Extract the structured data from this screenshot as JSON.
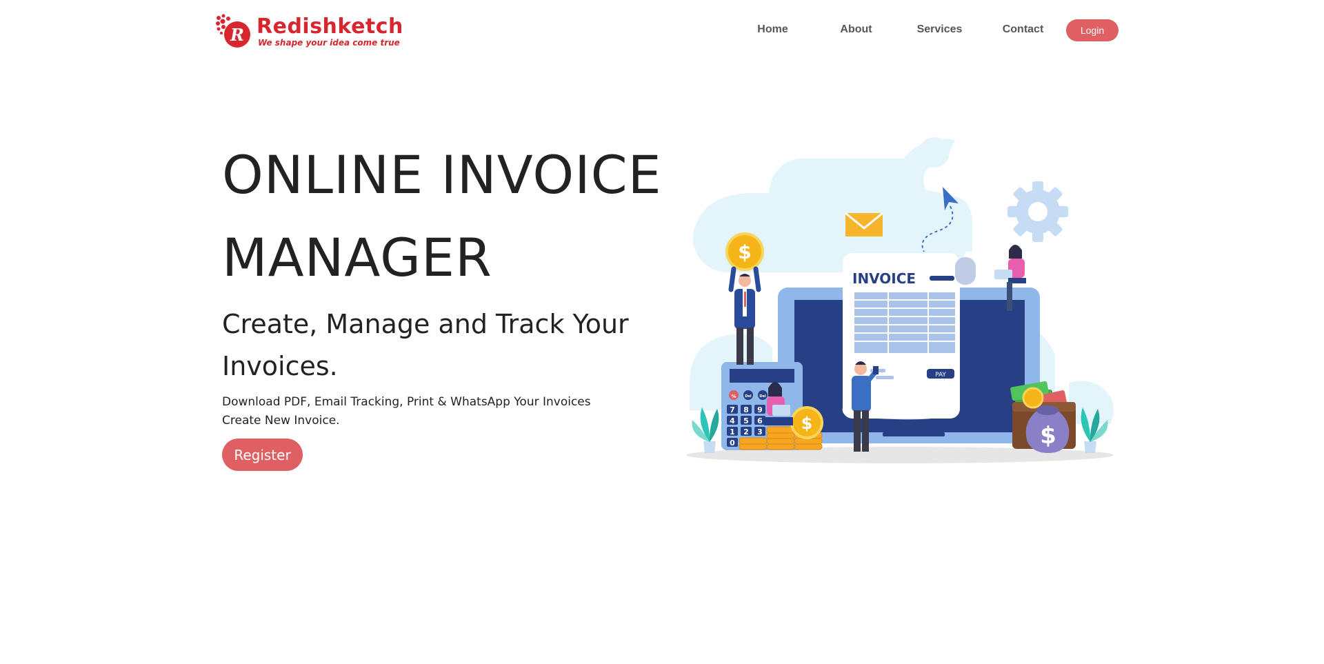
{
  "brand": {
    "name": "Redishketch",
    "tagline": "We shape your idea come true",
    "logo_letter": "R",
    "color": "#d8262f"
  },
  "nav": {
    "items": [
      {
        "label": "Home"
      },
      {
        "label": "About"
      },
      {
        "label": "Services"
      },
      {
        "label": "Contact"
      }
    ],
    "login_label": "Login"
  },
  "hero": {
    "title_line1": "ONLINE INVOICE",
    "title_line2": "MANAGER",
    "subtitle_line1": "Create, Manage and Track Your",
    "subtitle_line2": "Invoices.",
    "desc_line1": "Download PDF, Email Tracking, Print & WhatsApp Your Invoices",
    "desc_line2": "Create New Invoice.",
    "register_label": "Register"
  },
  "illustration": {
    "invoice_heading": "INVOICE",
    "pay_label": "PAY",
    "currency_symbol": "$",
    "calculator_keys": [
      "%",
      "Del",
      "Del",
      "7",
      "8",
      "9",
      "4",
      "5",
      "6",
      "1",
      "2",
      "3",
      "0"
    ],
    "colors": {
      "accent": "#e05f63",
      "navy": "#263f85",
      "sky": "#e3f4fb",
      "gold": "#f5b417",
      "laptop_frame": "#8fb7ea"
    }
  }
}
